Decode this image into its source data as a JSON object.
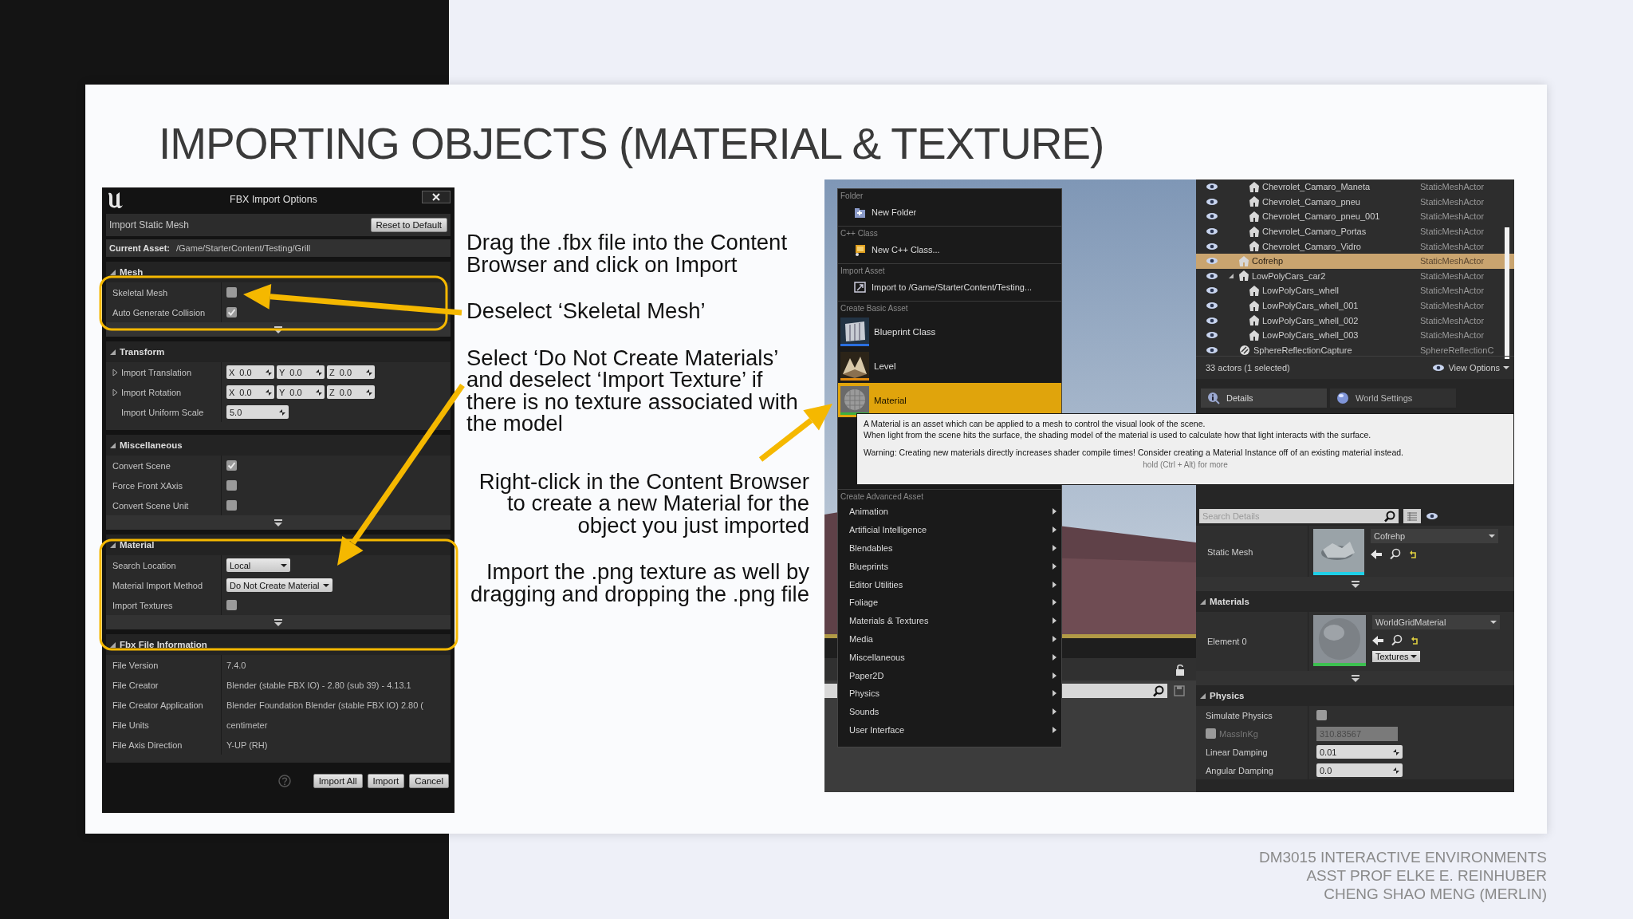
{
  "slide": {
    "title": "IMPORTING OBJECTS (MATERIAL & TEXTURE)",
    "footer": [
      "DM3015 INTERACTIVE ENVIRONMENTS",
      "ASST PROF ELKE E. REINHUBER",
      "CHENG SHAO MENG (MERLIN)"
    ]
  },
  "fbx_dialog": {
    "title": "FBX Import Options",
    "import_type": "Import Static Mesh",
    "reset_button": "Reset to Default",
    "current_asset": {
      "label": "Current Asset:",
      "value": "/Game/StarterContent/Testing/Grill"
    },
    "sections": [
      {
        "title": "Mesh",
        "expanded": true,
        "advanced": true,
        "rows": [
          {
            "kind": "checkbox",
            "label": "Skeletal Mesh",
            "checked": false
          },
          {
            "kind": "checkbox",
            "label": "Auto Generate Collision",
            "checked": true
          }
        ]
      },
      {
        "title": "Transform",
        "expanded": true,
        "advanced": false,
        "rows": [
          {
            "kind": "vector",
            "label": "Import Translation",
            "expandable": true,
            "fields": [
              {
                "axis": "X",
                "value": "0.0"
              },
              {
                "axis": "Y",
                "value": "0.0"
              },
              {
                "axis": "Z",
                "value": "0.0"
              }
            ]
          },
          {
            "kind": "vector",
            "label": "Import Rotation",
            "expandable": true,
            "fields": [
              {
                "axis": "X",
                "value": "0.0"
              },
              {
                "axis": "Y",
                "value": "0.0"
              },
              {
                "axis": "Z",
                "value": "0.0"
              }
            ]
          },
          {
            "kind": "number",
            "label": "Import Uniform Scale",
            "value": "5.0"
          }
        ]
      },
      {
        "title": "Miscellaneous",
        "expanded": true,
        "advanced": true,
        "rows": [
          {
            "kind": "checkbox",
            "label": "Convert Scene",
            "checked": true
          },
          {
            "kind": "checkbox",
            "label": "Force Front XAxis",
            "checked": false
          },
          {
            "kind": "checkbox",
            "label": "Convert Scene Unit",
            "checked": false
          }
        ]
      },
      {
        "title": "Material",
        "expanded": true,
        "advanced": true,
        "rows": [
          {
            "kind": "dropdown",
            "label": "Search Location",
            "value": "Local"
          },
          {
            "kind": "dropdown",
            "label": "Material Import Method",
            "value": "Do Not Create Material"
          },
          {
            "kind": "checkbox",
            "label": "Import Textures",
            "checked": false
          }
        ]
      },
      {
        "title": "Fbx File Information",
        "expanded": true,
        "advanced": false,
        "rows": [
          {
            "kind": "info",
            "label": "File Version",
            "value": "7.4.0"
          },
          {
            "kind": "info",
            "label": "File Creator",
            "value": "Blender (stable FBX IO) - 2.80 (sub 39) - 4.13.1"
          },
          {
            "kind": "info",
            "label": "File Creator Application",
            "value": "Blender Foundation Blender (stable FBX IO) 2.80 ("
          },
          {
            "kind": "info",
            "label": "File Units",
            "value": "centimeter"
          },
          {
            "kind": "info",
            "label": "File Axis Direction",
            "value": "Y-UP (RH)"
          }
        ]
      }
    ],
    "buttons": [
      "Import All",
      "Import",
      "Cancel"
    ]
  },
  "annotations": [
    {
      "text": "Drag the .fbx file into the Content Browser and click on Import",
      "right_aligned": false
    },
    {
      "text": "Deselect ‘Skeletal Mesh’",
      "right_aligned": false
    },
    {
      "text": "Select ‘Do Not Create Materials’ and deselect ‘Import Texture’ if there is no texture associated with the model",
      "right_aligned": false
    },
    {
      "text": "Right-click in the Content Browser to create a new Material for the object you just imported",
      "right_aligned": true
    },
    {
      "text": "Import the .png texture as well by dragging and dropping the .png file",
      "right_aligned": true
    }
  ],
  "editor": {
    "context_menu": {
      "sections": [
        {
          "heading": "Folder",
          "items": [
            {
              "kind": "small",
              "label": "New Folder",
              "selected": false
            }
          ]
        },
        {
          "heading": "C++ Class",
          "items": [
            {
              "kind": "small",
              "label": "New C++ Class...",
              "selected": false
            }
          ]
        },
        {
          "heading": "Import Asset",
          "items": [
            {
              "kind": "small",
              "label": "Import to /Game/StarterContent/Testing...",
              "selected": false
            }
          ]
        },
        {
          "heading": "Create Basic Asset",
          "items": [
            {
              "kind": "large",
              "label": "Blueprint Class",
              "selected": false
            },
            {
              "kind": "large",
              "label": "Level",
              "selected": false
            },
            {
              "kind": "large",
              "label": "Material",
              "selected": true
            }
          ]
        },
        {
          "heading": "Create Advanced Asset",
          "items": [
            {
              "kind": "submenu",
              "label": "Animation",
              "selected": false
            },
            {
              "kind": "submenu",
              "label": "Artificial Intelligence",
              "selected": false
            },
            {
              "kind": "submenu",
              "label": "Blendables",
              "selected": false
            },
            {
              "kind": "submenu",
              "label": "Blueprints",
              "selected": false
            },
            {
              "kind": "submenu",
              "label": "Editor Utilities",
              "selected": false
            },
            {
              "kind": "submenu",
              "label": "Foliage",
              "selected": false
            },
            {
              "kind": "submenu",
              "label": "Materials & Textures",
              "selected": false
            },
            {
              "kind": "submenu",
              "label": "Media",
              "selected": false
            },
            {
              "kind": "submenu",
              "label": "Miscellaneous",
              "selected": false
            },
            {
              "kind": "submenu",
              "label": "Paper2D",
              "selected": false
            },
            {
              "kind": "submenu",
              "label": "Physics",
              "selected": false
            },
            {
              "kind": "submenu",
              "label": "Sounds",
              "selected": false
            },
            {
              "kind": "submenu",
              "label": "User Interface",
              "selected": false
            }
          ]
        }
      ]
    },
    "tooltip": {
      "lines": [
        "A Material is an asset which can be applied to a mesh to control the visual look of the scene.",
        "When light from the scene hits the surface, the shading model of the material is used to calculate how that light interacts with the surface."
      ],
      "warning": "Warning: Creating new materials directly increases shader compile times!  Consider creating a Material Instance off of an existing material instead.",
      "hint": "hold (Ctrl + Alt) for more"
    },
    "outliner": {
      "rows": [
        {
          "kind": "continued",
          "children": [
            {
              "kind": "actor",
              "name": "Chevrolet_Camaro_Maneta",
              "type": "StaticMeshActor",
              "selected": false
            },
            {
              "kind": "actor",
              "name": "Chevrolet_Camaro_pneu",
              "type": "StaticMeshActor",
              "selected": false
            },
            {
              "kind": "actor",
              "name": "Chevrolet_Camaro_pneu_001",
              "type": "StaticMeshActor",
              "selected": false
            },
            {
              "kind": "actor",
              "name": "Chevrolet_Camaro_Portas",
              "type": "StaticMeshActor",
              "selected": false
            },
            {
              "kind": "actor",
              "name": "Chevrolet_Camaro_Vidro",
              "type": "StaticMeshActor",
              "selected": false
            }
          ]
        },
        {
          "kind": "actor",
          "name": "Cofrehp",
          "type": "StaticMeshActor",
          "selected": true
        },
        {
          "kind": "actor",
          "name": "LowPolyCars_car2",
          "type": "StaticMeshActor",
          "selected": false,
          "expanded": true,
          "children": [
            {
              "kind": "actor",
              "name": "LowPolyCars_whell",
              "type": "StaticMeshActor",
              "selected": false
            },
            {
              "kind": "actor",
              "name": "LowPolyCars_whell_001",
              "type": "StaticMeshActor",
              "selected": false
            },
            {
              "kind": "actor",
              "name": "LowPolyCars_whell_002",
              "type": "StaticMeshActor",
              "selected": false
            },
            {
              "kind": "actor",
              "name": "LowPolyCars_whell_003",
              "type": "StaticMeshActor",
              "selected": false
            }
          ]
        },
        {
          "kind": "capture",
          "name": "SphereReflectionCapture",
          "type": "SphereReflectionC",
          "selected": false
        }
      ],
      "status": "33 actors (1 selected)",
      "view_options": "View Options"
    },
    "details_tabs": [
      {
        "label": "Details",
        "selected": true
      },
      {
        "label": "World Settings",
        "selected": false
      }
    ],
    "details": {
      "search": {
        "placeholder": "Search Details"
      },
      "static_mesh": {
        "label": "Static Mesh",
        "asset": "Cofrehp"
      },
      "materials": {
        "title": "Materials",
        "label": "Element 0",
        "asset": "WorldGridMaterial",
        "textures_button": "Textures"
      },
      "physics": {
        "title": "Physics",
        "rows": [
          {
            "kind": "checkbox",
            "label": "Simulate Physics",
            "checked": false
          },
          {
            "kind": "mass",
            "label": "MassInKg",
            "checked": false,
            "value": "310.83567"
          },
          {
            "kind": "number",
            "label": "Linear Damping",
            "value": "0.01"
          },
          {
            "kind": "number",
            "label": "Angular Damping",
            "value": "0.0"
          }
        ]
      }
    }
  }
}
